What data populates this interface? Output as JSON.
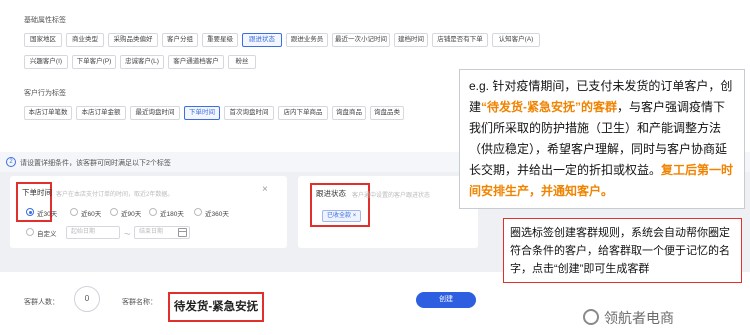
{
  "basic_section": {
    "title": "基础属性标签",
    "row1": [
      "国家地区",
      "商业类型",
      "采购品类偏好",
      "客户分组",
      "重要星级",
      "跟进状态",
      "跟进业务员",
      "最近一次小记时间",
      "建档时间",
      "店铺是否有下单",
      "认知客户(A)"
    ],
    "row2": [
      "兴趣客户(I)",
      "下单客户(P)",
      "忠诚客户(L)",
      "客户通道档客户",
      "粉丝"
    ]
  },
  "behavior_section": {
    "title": "客户行为标签",
    "row": [
      "本店订单笔数",
      "本店订单金额",
      "最近询盘时间",
      "下单时间",
      "首次询盘时间",
      "店内下单商品",
      "询盘商品",
      "询盘品类"
    ]
  },
  "step2": {
    "num": "2",
    "text": "请设置详细条件，该客群可同时满足以下2个标签"
  },
  "card_order_time": {
    "title": "下单时间",
    "desc": "客户在本店支付订单的时间，取近2年数据。",
    "options": [
      "近30天",
      "近60天",
      "近90天",
      "近180天",
      "近360天"
    ],
    "custom_label": "自定义",
    "start_placeholder": "起始日期",
    "end_placeholder": "结束日期",
    "range_sep": "～"
  },
  "card_follow_status": {
    "title": "跟进状态",
    "desc": "客户通中设置的客户跟进状态",
    "tag": "已收全款"
  },
  "bottom": {
    "count_label": "客群人数：",
    "count_value": "0",
    "name_label": "客群名称：",
    "name_value": "待发货-紧急安抚",
    "create_label": "创建"
  },
  "callout1": {
    "p1": "e.g. 针对疫情期间，已支付未发货的订单客户，创建",
    "p2": "“待发货-紧急安抚”的客群",
    "p3": "，与客户强调疫情下我们所采取的防护措施（卫生）和产能调整方法（供应稳定），希望客户理解，同时与客户协商延长交期，并给出一定的折扣或权益。",
    "p4": "复工后第一时间安排生产，并通知客户。"
  },
  "callout2": {
    "text": "圈选标签创建客群规则，系统会自动帮你圈定符合条件的客户，给客群取一个便于记忆的名字，点击“创建”即可生成客群"
  },
  "watermark": {
    "text": "领航者电商"
  },
  "colors": {
    "accent": "#3b6ee0",
    "highlight": "#f08300",
    "annotation": "#e0302c"
  }
}
